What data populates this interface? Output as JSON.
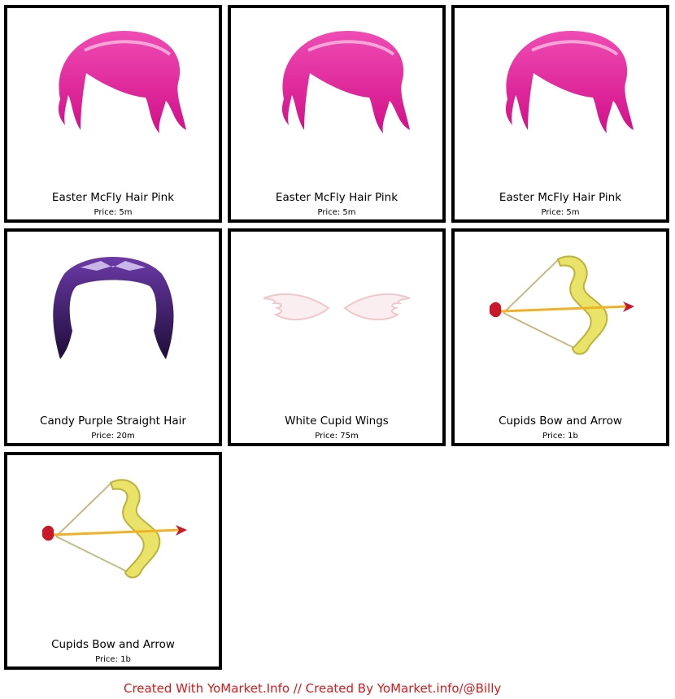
{
  "items": [
    {
      "name": "Easter McFly Hair Pink",
      "price": "Price: 5m",
      "icon": "pink-hair-icon"
    },
    {
      "name": "Easter McFly Hair Pink",
      "price": "Price: 5m",
      "icon": "pink-hair-icon"
    },
    {
      "name": "Easter McFly Hair Pink",
      "price": "Price: 5m",
      "icon": "pink-hair-icon"
    },
    {
      "name": "Candy Purple Straight Hair",
      "price": "Price: 20m",
      "icon": "purple-hair-icon"
    },
    {
      "name": "White Cupid Wings",
      "price": "Price: 75m",
      "icon": "cupid-wings-icon"
    },
    {
      "name": "Cupids Bow and Arrow",
      "price": "Price: 1b",
      "icon": "bow-and-arrow-icon"
    },
    {
      "name": "Cupids Bow and Arrow",
      "price": "Price: 1b",
      "icon": "bow-and-arrow-icon"
    }
  ],
  "footer": {
    "text": "Created With YoMarket.Info // Created By YoMarket.info/@Billy"
  },
  "colors": {
    "border": "#000000",
    "footer": "#e01818",
    "hair_pink": "#e8139a",
    "hair_purple": "#3a1a5e",
    "bow": "#e8e05a",
    "arrow_head": "#c81e2e"
  }
}
